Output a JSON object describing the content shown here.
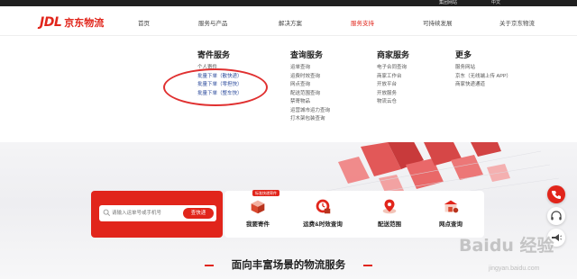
{
  "topbar": {
    "region": "集团网站",
    "lang": "中文"
  },
  "header": {
    "logo_mark": "JDL",
    "logo_text": "京东物流",
    "nav": [
      "首页",
      "服务与产品",
      "解决方案",
      "服务支持",
      "可持续发展",
      "关于京东物流"
    ],
    "active_nav": "服务支持"
  },
  "dropdown": {
    "columns": [
      {
        "title": "寄件服务",
        "items": [
          "个人寄件",
          "批量下单（散快递）",
          "批量下单（零担快）",
          "批量下单（整车快）"
        ]
      },
      {
        "title": "查询服务",
        "items": [
          "运单查询",
          "运费时效查询",
          "网点查询",
          "配送范围查询",
          "禁寄物品",
          "运营城市运力查询",
          "打木架包装查询"
        ]
      },
      {
        "title": "商家服务",
        "items": [
          "电子合同查询",
          "商家工作台",
          "开放平台",
          "开放服务",
          "物流云仓"
        ]
      },
      {
        "title": "更多",
        "items": [
          "服务网站",
          "京东（无线端上传 APP）",
          "商家快递通道"
        ]
      }
    ]
  },
  "search": {
    "placeholder": "请输入运单号或手机号",
    "button": "查快递"
  },
  "services": {
    "tag": "标准快递寄件",
    "items": [
      {
        "label": "我要寄件",
        "icon": "send-package-icon"
      },
      {
        "label": "运费&时效查询",
        "icon": "freight-timing-icon"
      },
      {
        "label": "配送范围",
        "icon": "delivery-range-icon"
      },
      {
        "label": "网点查询",
        "icon": "branch-query-icon"
      }
    ]
  },
  "section": {
    "title": "面向丰富场景的物流服务"
  },
  "watermark": {
    "main": "Baidu 经验",
    "sub": "jingyan.baidu.com"
  },
  "colors": {
    "brand": "#e1251b",
    "highlight": "#2b4a9c",
    "annotation": "#e03030"
  }
}
